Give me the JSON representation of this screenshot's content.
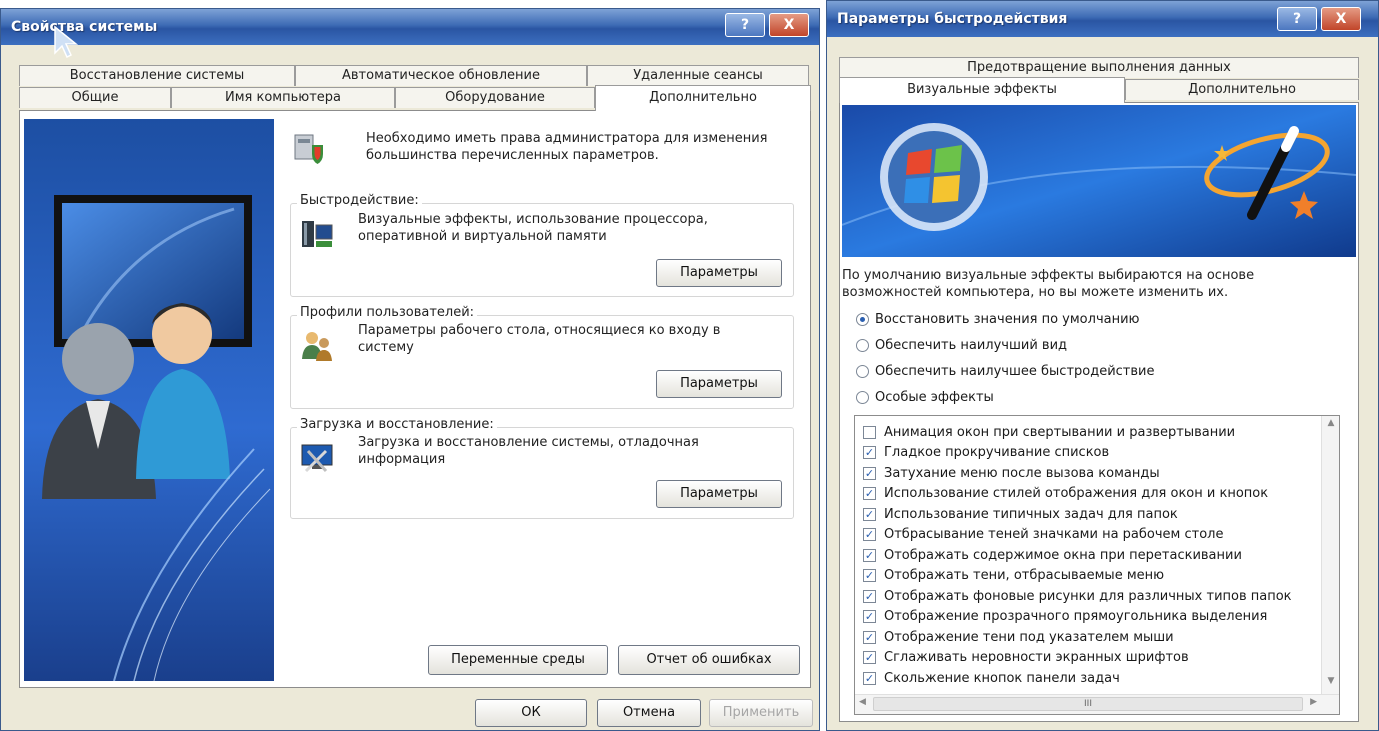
{
  "system_window": {
    "title": "Свойства системы",
    "help_btn": "?",
    "close_btn": "X",
    "tabs_row1": [
      "Восстановление системы",
      "Автоматическое обновление",
      "Удаленные сеансы"
    ],
    "tabs_row2": [
      "Общие",
      "Имя компьютера",
      "Оборудование",
      "Дополнительно"
    ],
    "admin_note": "Необходимо иметь права администратора для изменения большинства перечисленных параметров.",
    "groups": [
      {
        "label": "Быстродействие:",
        "desc": "Визуальные эффекты, использование процессора, оперативной и виртуальной памяти",
        "button": "Параметры"
      },
      {
        "label": "Профили пользователей:",
        "desc": "Параметры рабочего стола, относящиеся ко входу в систему",
        "button": "Параметры"
      },
      {
        "label": "Загрузка и восстановление:",
        "desc": "Загрузка и восстановление системы, отладочная информация",
        "button": "Параметры"
      }
    ],
    "env_button": "Переменные среды",
    "error_button": "Отчет об ошибках",
    "ok": "ОК",
    "cancel": "Отмена",
    "apply": "Применить"
  },
  "perf_window": {
    "title": "Параметры быстродействия",
    "help_btn": "?",
    "close_btn": "X",
    "tab_top": "Предотвращение выполнения данных",
    "tabs": [
      "Визуальные эффекты",
      "Дополнительно"
    ],
    "intro": "По умолчанию визуальные эффекты выбираются на основе возможностей компьютера, но вы можете изменить их.",
    "radios": [
      {
        "label": "Восстановить значения по умолчанию",
        "selected": true
      },
      {
        "label": "Обеспечить наилучший вид",
        "selected": false
      },
      {
        "label": "Обеспечить наилучшее быстродействие",
        "selected": false
      },
      {
        "label": "Особые эффекты",
        "selected": false
      }
    ],
    "effects": [
      {
        "label": "Анимация окон при свертывании и развертывании",
        "checked": false
      },
      {
        "label": "Гладкое прокручивание списков",
        "checked": true
      },
      {
        "label": "Затухание меню после вызова команды",
        "checked": true
      },
      {
        "label": "Использование стилей отображения для окон и кнопок",
        "checked": true
      },
      {
        "label": "Использование типичных задач для папок",
        "checked": true
      },
      {
        "label": "Отбрасывание теней значками на рабочем столе",
        "checked": true
      },
      {
        "label": "Отображать содержимое окна при перетаскивании",
        "checked": true
      },
      {
        "label": "Отображать тени, отбрасываемые меню",
        "checked": true
      },
      {
        "label": "Отображать фоновые рисунки для различных типов папок",
        "checked": true
      },
      {
        "label": "Отображение прозрачного прямоугольника выделения",
        "checked": true
      },
      {
        "label": "Отображение тени под указателем мыши",
        "checked": true
      },
      {
        "label": "Сглаживать неровности экранных шрифтов",
        "checked": true
      },
      {
        "label": "Скольжение кнопок панели задач",
        "checked": true
      }
    ],
    "hscroll_grip": "III"
  }
}
